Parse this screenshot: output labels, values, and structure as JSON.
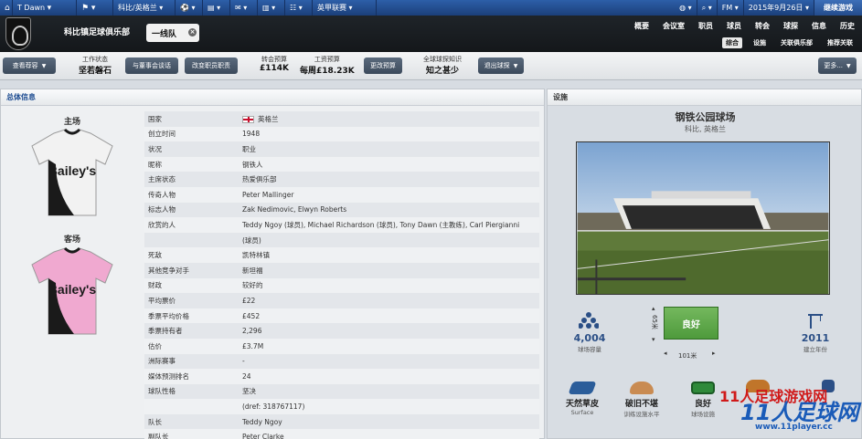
{
  "topbar": {
    "manager": "T Dawn",
    "club_tab": "科比/英格兰",
    "league_tab": "英甲联赛",
    "date": "2015年9月26日",
    "continue_label": "继续游戏"
  },
  "header": {
    "club_name": "科比镇足球俱乐部",
    "team_selector": "一线队",
    "main_nav": [
      "概要",
      "会议室",
      "职员",
      "球员",
      "转会",
      "球探",
      "信息",
      "历史"
    ],
    "sub_nav": [
      "综合",
      "设施",
      "关联俱乐部",
      "推荐关联"
    ],
    "sub_nav_active": "综合"
  },
  "actionbar": {
    "view_profile_label": "查看荐容",
    "job_status_label": "工作状态",
    "job_status_value": "坚若磐石",
    "talk_board_label": "与董事会谈话",
    "change_staff_label": "改变职员职责",
    "transfer_budget_label": "转会预算",
    "transfer_budget_value": "£114K",
    "wage_budget_label": "工资预算",
    "wage_budget_value": "每周£18.23K",
    "change_budget_label": "更改预算",
    "knowledge_label": "全球球探知识",
    "knowledge_value": "知之甚少",
    "withdraw_label": "退出球探",
    "more_label": "更多..."
  },
  "overview": {
    "panel_title": "总体信息",
    "home_kit_label": "主场",
    "away_kit_label": "客场",
    "kit_sponsor": "Bailey's",
    "colors": {
      "home_shirt": "#f2f2f2",
      "home_trim": "#1a1a1a",
      "away_shirt": "#f0a9d0",
      "away_trim": "#1a1a1a"
    },
    "rows": [
      {
        "key": "国家",
        "value": "英格兰",
        "flag": "england"
      },
      {
        "key": "创立时间",
        "value": "1948"
      },
      {
        "key": "状况",
        "value": "职业"
      },
      {
        "key": "昵称",
        "value": "钢铁人"
      },
      {
        "key": "主席状态",
        "value": "热爱俱乐部"
      },
      {
        "key": "传奇人物",
        "value": "Peter Mallinger"
      },
      {
        "key": "标志人物",
        "value": "Zak Nedimovic, Elwyn Roberts"
      },
      {
        "key": "欣赏的人",
        "value": "Teddy Ngoy (球员), Michael Richardson (球员), Tony Dawn (主教练), Carl Piergianni"
      },
      {
        "key": "",
        "value": "(球员)"
      },
      {
        "key": "死敌",
        "value": "凯特林镇"
      },
      {
        "key": "其他竞争对手",
        "value": "新坦福"
      },
      {
        "key": "财政",
        "value": "较好的"
      },
      {
        "key": "平均票价",
        "value": "£22"
      },
      {
        "key": "季票平均价格",
        "value": "£452"
      },
      {
        "key": "季票持有者",
        "value": "2,296"
      },
      {
        "key": "估价",
        "value": "£3.7M"
      },
      {
        "key": "洲际赛事",
        "value": "-"
      },
      {
        "key": "媒体预测排名",
        "value": "24"
      },
      {
        "key": "球队性格",
        "value": "坚决"
      },
      {
        "key": "",
        "value": "(dref: 318767117)"
      },
      {
        "key": "队长",
        "value": "Teddy Ngoy"
      },
      {
        "key": "副队长",
        "value": "Peter Clarke"
      }
    ]
  },
  "facilities": {
    "panel_title": "设施",
    "stadium_name": "钢铁公园球场",
    "stadium_location": "科比, 英格兰",
    "capacity_value": "4,004",
    "capacity_label": "球场容量",
    "pitch_condition": "良好",
    "pitch_length": "101米",
    "pitch_width": "65米",
    "built_year": "2011",
    "built_label": "建立年份",
    "surface_value": "天然草皮",
    "surface_label": "Surface",
    "training_value": "破旧不堪",
    "training_label": "训练设施水平",
    "youth_value": "良好",
    "youth_label": "球场设施"
  },
  "watermark": {
    "line1": "11人足球游戏网",
    "line2": "11人足球网",
    "line3": "www.11player.cc"
  }
}
